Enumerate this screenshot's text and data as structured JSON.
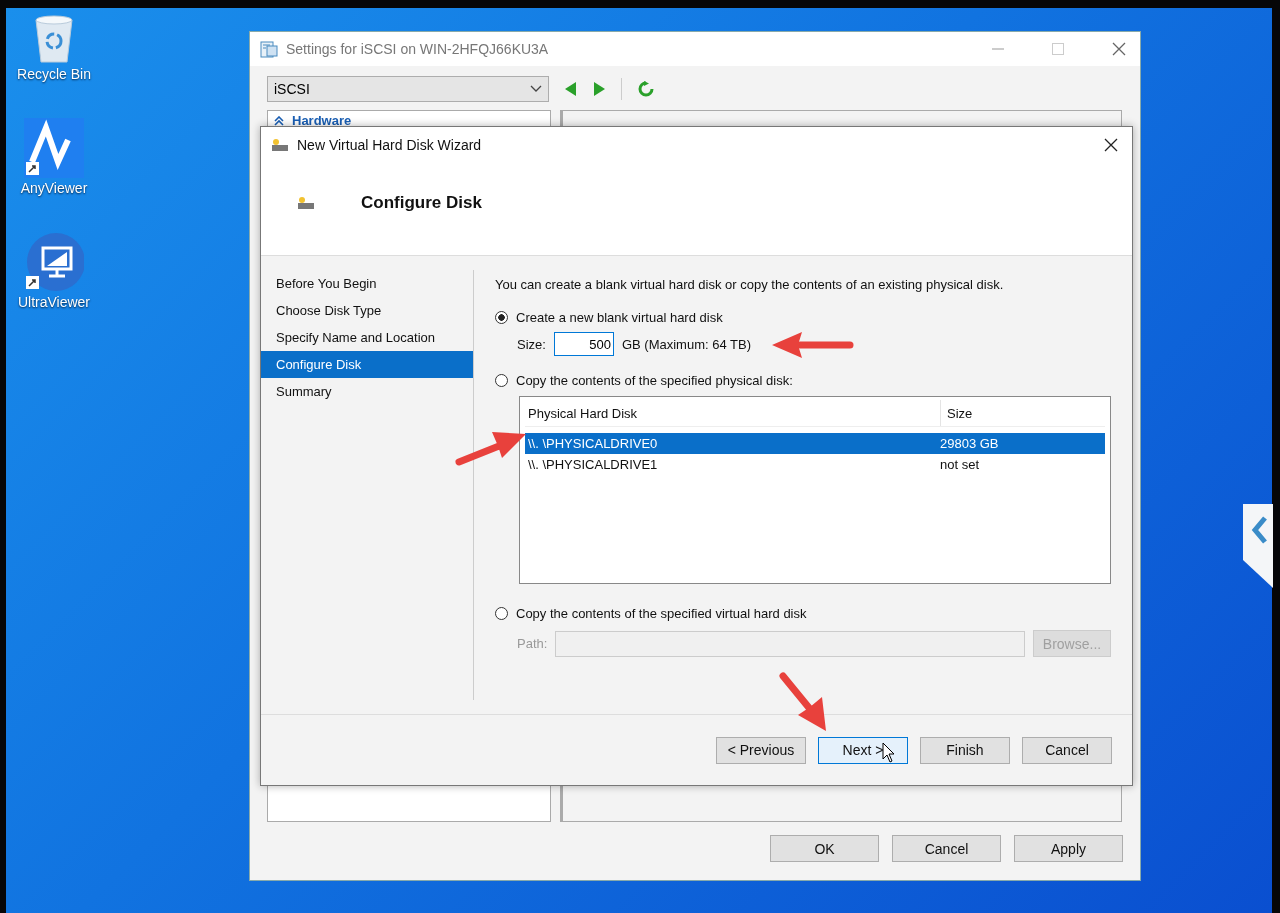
{
  "desktop": {
    "icons": [
      {
        "kind": "recycle-bin",
        "label": "Recycle Bin"
      },
      {
        "kind": "anyviewer",
        "label": "AnyViewer"
      },
      {
        "kind": "ultraviewer",
        "label": "UltraViewer"
      }
    ]
  },
  "settings_window": {
    "title": "Settings for iSCSI on WIN-2HFQJ66KU3A",
    "dropdown": {
      "value": "iSCSI"
    },
    "tree_header": "Hardware",
    "buttons": [
      "OK",
      "Cancel",
      "Apply"
    ]
  },
  "wizard": {
    "title": "New Virtual Hard Disk Wizard",
    "heading": "Configure Disk",
    "steps": [
      {
        "label": "Before You Begin",
        "selected": false
      },
      {
        "label": "Choose Disk Type",
        "selected": false
      },
      {
        "label": "Specify Name and Location",
        "selected": false
      },
      {
        "label": "Configure Disk",
        "selected": true
      },
      {
        "label": "Summary",
        "selected": false
      }
    ],
    "intro": "You can create a blank virtual hard disk or copy the contents of an existing physical disk.",
    "options": [
      {
        "kind": "size",
        "label": "Create a new blank virtual hard disk",
        "selected": true
      },
      {
        "kind": "physical",
        "label": "Copy the contents of the specified physical disk:",
        "selected": false
      },
      {
        "kind": "virtual",
        "label": "Copy the contents of the specified virtual hard disk",
        "selected": false
      }
    ],
    "size": {
      "label": "Size:",
      "value": "500",
      "unit": "GB (Maximum: 64 TB)"
    },
    "table": {
      "columns": [
        "Physical Hard Disk",
        "Size"
      ],
      "rows": [
        {
          "disk": "\\\\. \\PHYSICALDRIVE0",
          "size": "29803 GB",
          "selected": true
        },
        {
          "disk": "\\\\. \\PHYSICALDRIVE1",
          "size": "not set",
          "selected": false
        }
      ]
    },
    "path": {
      "label": "Path:",
      "disabled": true
    },
    "browse": {
      "label": "Browse...",
      "disabled": true
    },
    "buttons": [
      {
        "label": "< Previous",
        "focused": false
      },
      {
        "label": "Next >",
        "focused": true
      },
      {
        "label": "Finish",
        "focused": false
      },
      {
        "label": "Cancel",
        "focused": false
      }
    ]
  }
}
